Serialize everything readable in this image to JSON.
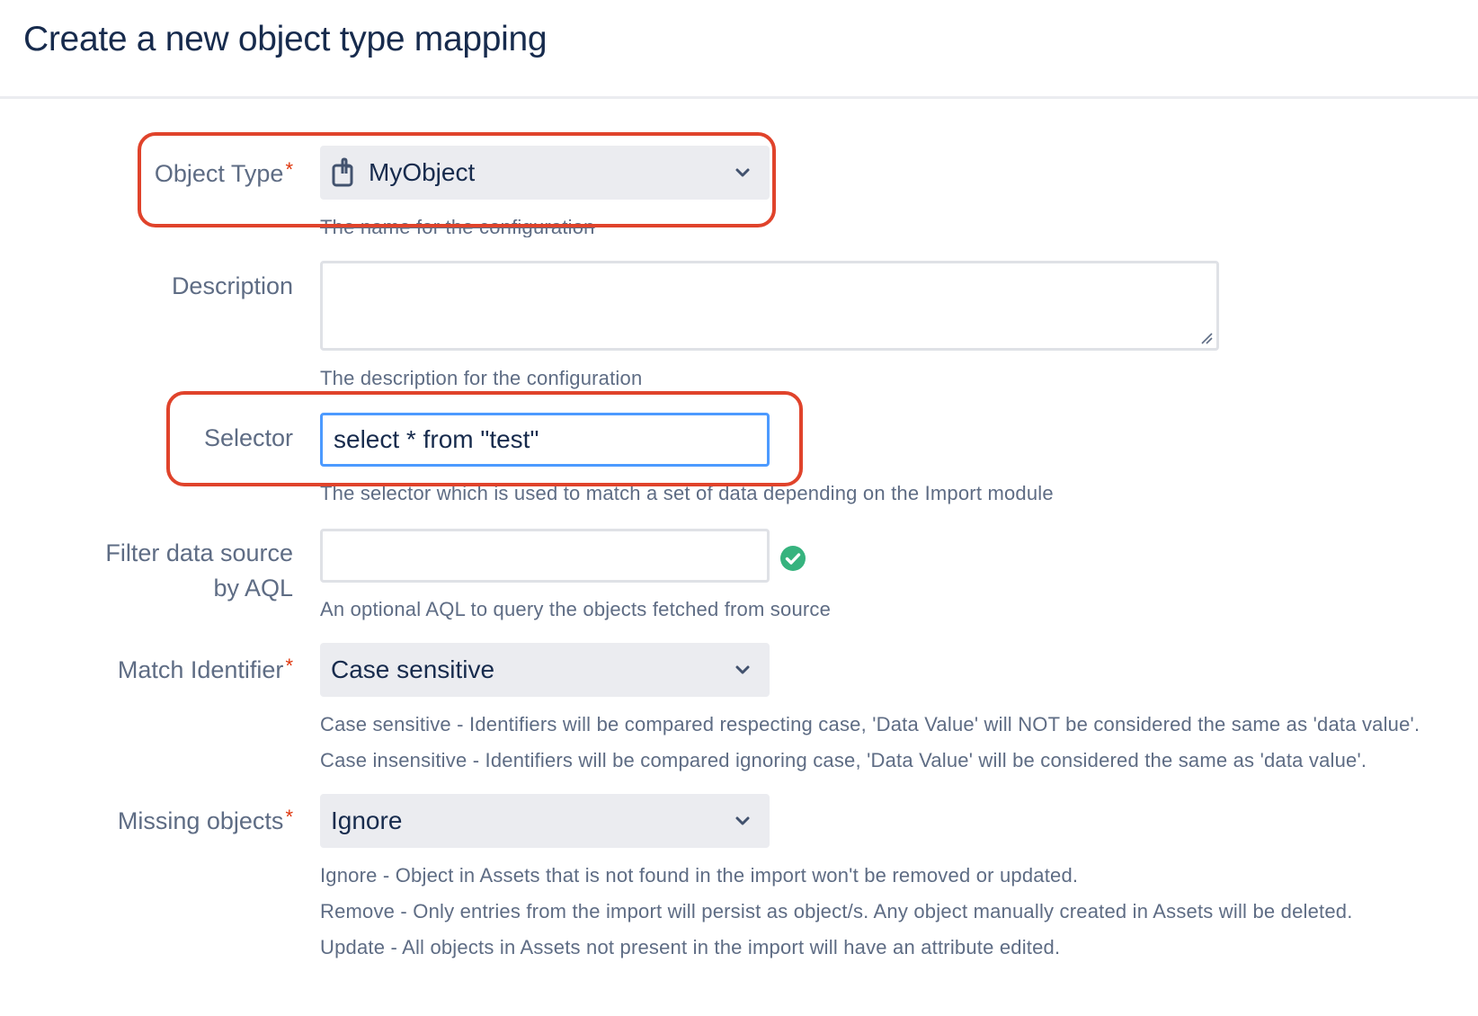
{
  "page": {
    "title": "Create a new object type mapping"
  },
  "form": {
    "object_type": {
      "label": "Object Type",
      "required_marker": "*",
      "value": "MyObject",
      "icon": "object-icon",
      "help": "The name for the configuration"
    },
    "description": {
      "label": "Description",
      "value": "",
      "help": "The description for the configuration"
    },
    "selector": {
      "label": "Selector",
      "value": "select * from \"test\"",
      "help": "The selector which is used to match a set of data depending on the Import module"
    },
    "filter_aql": {
      "label_line1": "Filter data source",
      "label_line2": "by AQL",
      "value": "",
      "status_icon": "check-circle-icon",
      "help": "An optional AQL to query the objects fetched from source"
    },
    "match_identifier": {
      "label": "Match Identifier",
      "required_marker": "*",
      "value": "Case sensitive",
      "help": [
        "Case sensitive - Identifiers will be compared respecting case, 'Data Value' will NOT be considered the same as 'data value'.",
        "Case insensitive - Identifiers will be compared ignoring case, 'Data Value' will be considered the same as 'data value'."
      ]
    },
    "missing_objects": {
      "label": "Missing objects",
      "required_marker": "*",
      "value": "Ignore",
      "help": [
        "Ignore - Object in Assets that is not found in the import won't be removed or updated.",
        "Remove - Only entries from the import will persist as object/s. Any object manually created in Assets will be deleted.",
        "Update - All objects in Assets not present in the import will have an attribute edited."
      ]
    }
  },
  "colors": {
    "text": "#172b4d",
    "label": "#5e6c84",
    "required": "#de350b",
    "focus_border": "#4c9aff",
    "highlight": "#e0432b",
    "success": "#36b37e"
  }
}
